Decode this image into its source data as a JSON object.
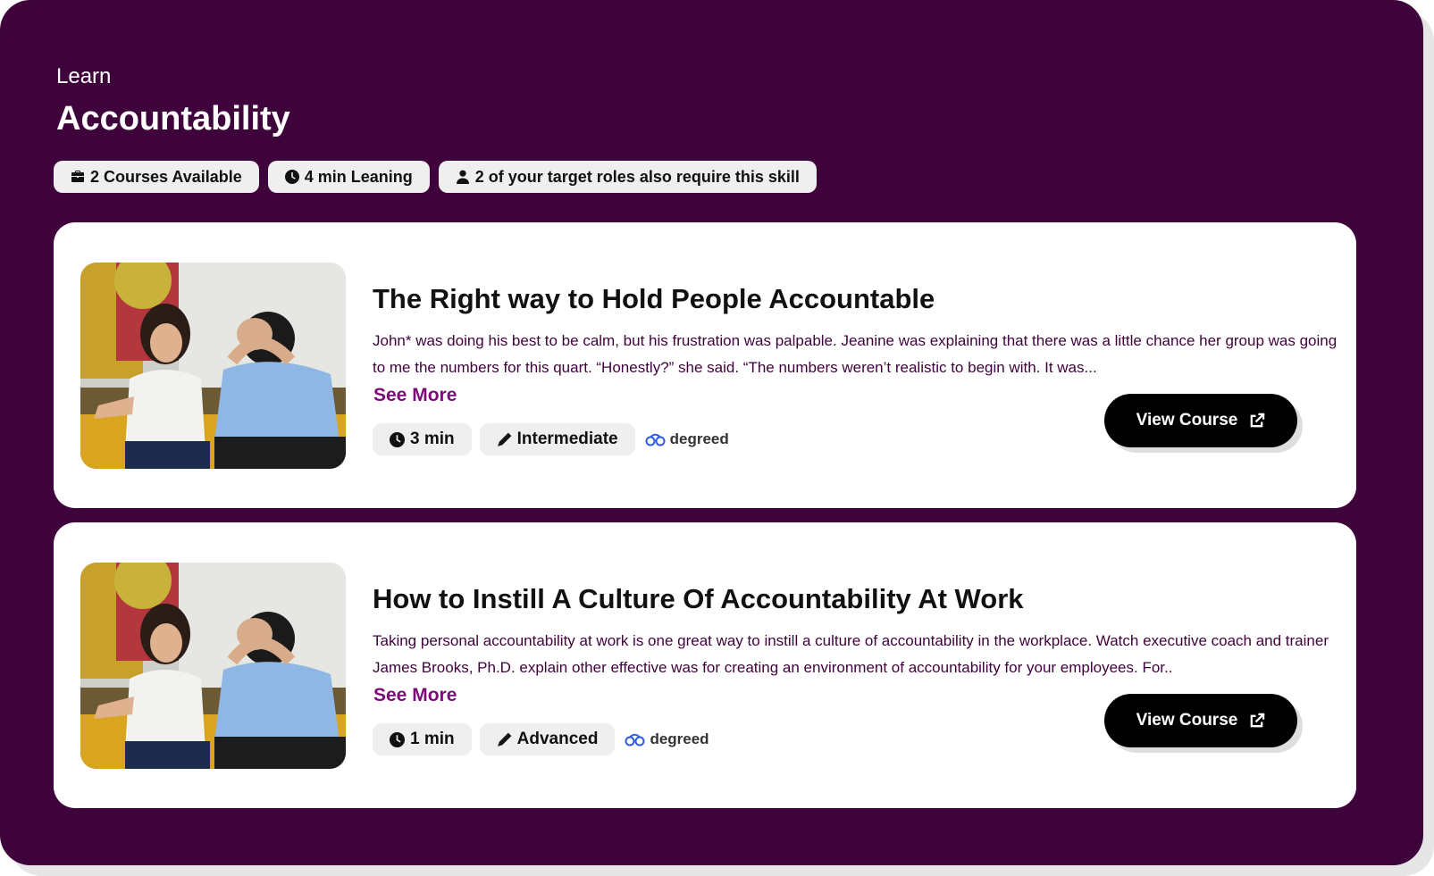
{
  "header": {
    "breadcrumb": "Learn",
    "title": "Accountability"
  },
  "stats": [
    {
      "icon": "briefcase-icon",
      "label": "2 Courses Available"
    },
    {
      "icon": "clock-icon",
      "label": "4 min Leaning"
    },
    {
      "icon": "user-icon",
      "label": "2 of your target roles also require this skill"
    }
  ],
  "courses": [
    {
      "title": "The Right way to Hold People Accountable",
      "description": "John* was doing his best to be calm, but his frustration was palpable. Jeanine was explaining that there was a little chance her group was going to me the numbers for this quart. “Honestly?” she said. “The numbers weren’t realistic to begin with. It was...",
      "see_more": "See More",
      "duration": "3 min",
      "level": "Intermediate",
      "provider": "degreed",
      "button": "View Course"
    },
    {
      "title": "How to Instill A Culture Of Accountability At Work",
      "description": "Taking personal accountability at work is one great way to instill a culture of accountability in the workplace. Watch executive coach and trainer James Brooks, Ph.D. explain other effective was for creating an environment of accountability for your employees. For..",
      "see_more": "See More",
      "duration": "1 min",
      "level": "Advanced",
      "provider": "degreed",
      "button": "View Course"
    }
  ],
  "colors": {
    "panel_bg": "#3f033c",
    "accent": "#7d0a7a",
    "button_bg": "#000000",
    "provider_blue": "#2f5bea"
  }
}
